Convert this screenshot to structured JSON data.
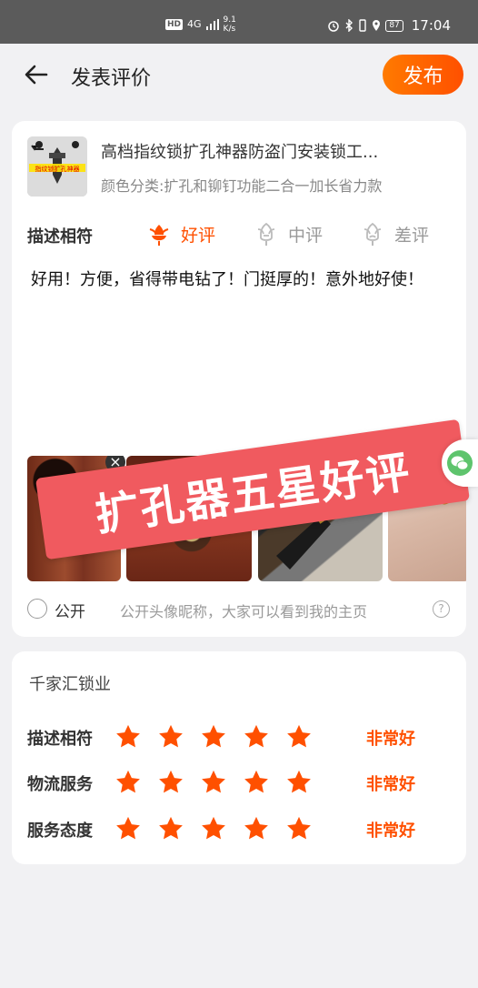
{
  "status_bar": {
    "network_badge": "HD",
    "signal": "4G",
    "speed_value": "9.1",
    "speed_unit": "K/s",
    "battery": "87",
    "time": "17:04"
  },
  "header": {
    "back_icon": "arrow-left-icon",
    "title": "发表评价",
    "publish_label": "发布"
  },
  "product": {
    "thumb_text": "指纹锁扩孔神器",
    "title": "高档指纹锁扩孔神器防盗门安装锁工...",
    "sku": "颜色分类:扩孔和铆钉功能二合一加长省力款"
  },
  "rating": {
    "label": "描述相符",
    "options": [
      {
        "label": "好评",
        "icon": "flower-icon",
        "active": true
      },
      {
        "label": "中评",
        "icon": "neutral-face-icon",
        "active": false
      },
      {
        "label": "差评",
        "icon": "sad-face-icon",
        "active": false
      }
    ]
  },
  "review_text": "好用！方便，省得带电钻了！门挺厚的！意外地好使！",
  "stamp_text": "扩孔器五星好评",
  "photos": {
    "count": 4,
    "remove_icon": "close-icon"
  },
  "public": {
    "label": "公开",
    "hint": "公开头像昵称，大家可以看到我的主页",
    "help_symbol": "?"
  },
  "shop": {
    "name": "千家汇锁业",
    "rows": [
      {
        "label": "描述相符",
        "stars": 5,
        "value": "非常好"
      },
      {
        "label": "物流服务",
        "stars": 5,
        "value": "非常好"
      },
      {
        "label": "服务态度",
        "stars": 5,
        "value": "非常好"
      }
    ]
  },
  "colors": {
    "accent": "#ff5000",
    "stamp": "#f05a5f"
  }
}
